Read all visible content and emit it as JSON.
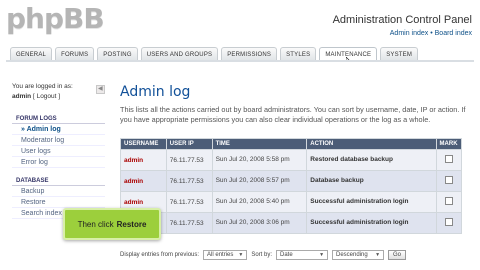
{
  "header": {
    "logo_text": "phpBB",
    "panel_title": "Administration Control Panel",
    "admin_index": "Admin index",
    "separator": " • ",
    "board_index": "Board index"
  },
  "tabs": [
    {
      "label": "GENERAL"
    },
    {
      "label": "FORUMS"
    },
    {
      "label": "POSTING"
    },
    {
      "label": "USERS AND GROUPS"
    },
    {
      "label": "PERMISSIONS"
    },
    {
      "label": "STYLES"
    },
    {
      "label": "MAINTENANCE"
    },
    {
      "label": "SYSTEM"
    }
  ],
  "active_tab": "MAINTENANCE",
  "sidebar": {
    "logged_in_text": "You are logged in as:",
    "username": "admin",
    "logout": "[ Logout ]",
    "sections": [
      {
        "title": "FORUM LOGS",
        "items": [
          "Admin log",
          "Moderator log",
          "User logs",
          "Error log"
        ]
      },
      {
        "title": "DATABASE",
        "items": [
          "Backup",
          "Restore",
          "Search index"
        ]
      }
    ]
  },
  "main": {
    "title": "Admin log",
    "description": "This lists all the actions carried out by board administrators. You can sort by username, date, IP or action. If you have appropriate permissions you can also clear individual operations or the log as a whole."
  },
  "table": {
    "headers": [
      "USERNAME",
      "USER IP",
      "TIME",
      "ACTION",
      "MARK"
    ],
    "rows": [
      {
        "user": "admin",
        "ip": "76.11.77.53",
        "time": "Sun Jul 20, 2008 5:58 pm",
        "action": "Restored database backup"
      },
      {
        "user": "admin",
        "ip": "76.11.77.53",
        "time": "Sun Jul 20, 2008 5:57 pm",
        "action": "Database backup"
      },
      {
        "user": "admin",
        "ip": "76.11.77.53",
        "time": "Sun Jul 20, 2008 5:40 pm",
        "action": "Successful administration login"
      },
      {
        "user": "admin",
        "ip": "76.11.77.53",
        "time": "Sun Jul 20, 2008 3:06 pm",
        "action": "Successful administration login"
      }
    ]
  },
  "footer": {
    "display_label": "Display entries from previous:",
    "display_value": "All entries",
    "sort_label": "Sort by:",
    "sort_value": "Date",
    "order_value": "Descending",
    "go_label": "Go"
  },
  "callout": {
    "prefix": "Then click",
    "target": "Restore"
  },
  "colors": {
    "accent": "#115098",
    "table_header": "#4c5d77",
    "callout_bg": "#9ccf3c",
    "username": "#aa0000"
  }
}
